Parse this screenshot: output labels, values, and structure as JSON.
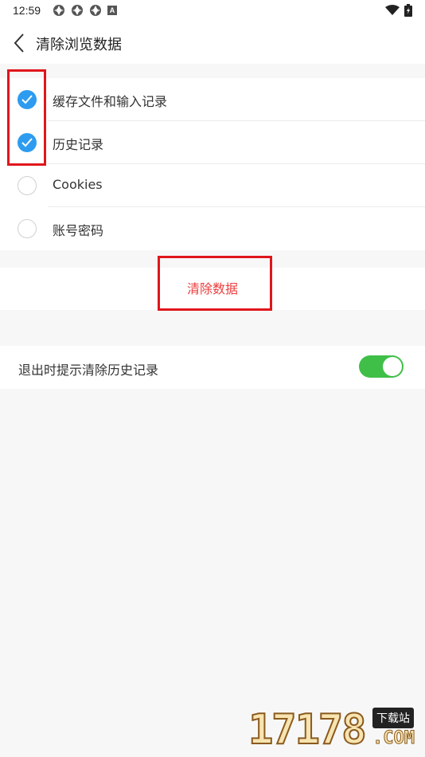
{
  "status_bar": {
    "time": "12:59",
    "notification_icons": [
      "app-notification-icon",
      "app-notification-icon",
      "app-notification-icon",
      "a-badge-icon"
    ],
    "badge_letter": "A",
    "right_icons": [
      "wifi-icon",
      "battery-icon"
    ]
  },
  "nav": {
    "title": "清除浏览数据",
    "back_icon": "chevron-left-icon"
  },
  "options": [
    {
      "label": "缓存文件和输入记录",
      "checked": true
    },
    {
      "label": "历史记录",
      "checked": true
    },
    {
      "label": "Cookies",
      "checked": false
    },
    {
      "label": "账号密码",
      "checked": false
    }
  ],
  "clear_button": {
    "label": "清除数据",
    "color": "#ee3d3d"
  },
  "exit_prompt": {
    "label": "退出时提示清除历史记录",
    "toggle_on": true,
    "toggle_color": "#3fbf48"
  },
  "accent_color": "#2d9cf0",
  "highlight_color": "#e0161b",
  "watermark": {
    "digits": "17178",
    "tag": "下载站",
    "suffix": ".COM"
  }
}
